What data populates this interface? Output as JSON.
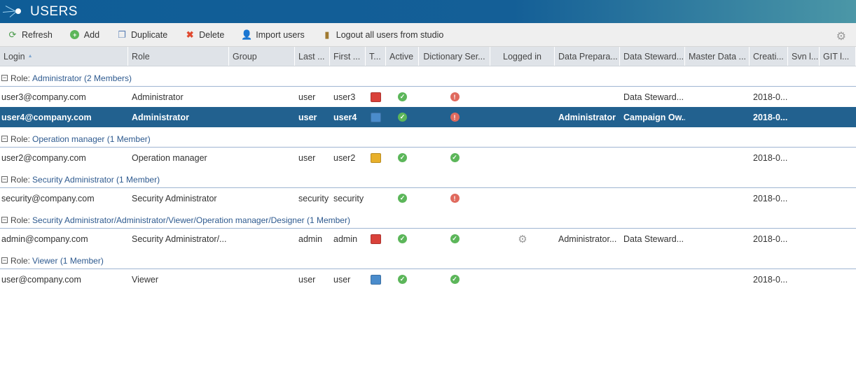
{
  "title": "USERS",
  "toolbar": {
    "refresh": "Refresh",
    "add": "Add",
    "duplicate": "Duplicate",
    "delete": "Delete",
    "import": "Import users",
    "logout": "Logout all users from studio"
  },
  "columns": [
    "Login",
    "Role",
    "Group",
    "Last ...",
    "First ...",
    "T...",
    "Active",
    "Dictionary Ser...",
    "Logged in",
    "Data Prepara...",
    "Data Steward...",
    "Master Data ...",
    "Creati...",
    "Svn l...",
    "GIT l..."
  ],
  "sort_indicator": "▲",
  "groups": [
    {
      "prefix": "Role:",
      "name": "Administrator (2 Members)",
      "rows": [
        {
          "login": "user3@company.com",
          "role": "Administrator",
          "group": "",
          "last": "user",
          "first": "user3",
          "type": "red",
          "active": "ok",
          "dict": "err",
          "logged": "",
          "prep": "",
          "steward": "Data Steward...",
          "master": "",
          "created": "2018-0...",
          "svn": "",
          "git": "",
          "selected": false
        },
        {
          "login": "user4@company.com",
          "role": "Administrator",
          "group": "",
          "last": "user",
          "first": "user4",
          "type": "blue",
          "active": "ok",
          "dict": "err",
          "logged": "",
          "prep": "Administrator",
          "steward": "Campaign Ow...",
          "master": "",
          "created": "2018-0...",
          "svn": "",
          "git": "",
          "selected": true
        }
      ]
    },
    {
      "prefix": "Role:",
      "name": "Operation manager (1 Member)",
      "rows": [
        {
          "login": "user2@company.com",
          "role": "Operation manager",
          "group": "",
          "last": "user",
          "first": "user2",
          "type": "yellow",
          "active": "ok",
          "dict": "ok",
          "logged": "",
          "prep": "",
          "steward": "",
          "master": "",
          "created": "2018-0...",
          "svn": "",
          "git": "",
          "selected": false
        }
      ]
    },
    {
      "prefix": "Role:",
      "name": "Security Administrator (1 Member)",
      "rows": [
        {
          "login": "security@company.com",
          "role": "Security Administrator",
          "group": "",
          "last": "security",
          "first": "security",
          "type": "",
          "active": "ok",
          "dict": "err",
          "logged": "",
          "prep": "",
          "steward": "",
          "master": "",
          "created": "2018-0...",
          "svn": "",
          "git": "",
          "selected": false
        }
      ]
    },
    {
      "prefix": "Role:",
      "name": "Security Administrator/Administrator/Viewer/Operation manager/Designer (1 Member)",
      "rows": [
        {
          "login": "admin@company.com",
          "role": "Security Administrator/...",
          "group": "",
          "last": "admin",
          "first": "admin",
          "type": "red",
          "active": "ok",
          "dict": "ok",
          "logged": "gear",
          "prep": "Administrator...",
          "steward": "Data Steward...",
          "master": "",
          "created": "2018-0...",
          "svn": "",
          "git": "",
          "selected": false
        }
      ]
    },
    {
      "prefix": "Role:",
      "name": "Viewer (1 Member)",
      "rows": [
        {
          "login": "user@company.com",
          "role": "Viewer",
          "group": "",
          "last": "user",
          "first": "user",
          "type": "blue",
          "active": "ok",
          "dict": "ok",
          "logged": "",
          "prep": "",
          "steward": "",
          "master": "",
          "created": "2018-0...",
          "svn": "",
          "git": "",
          "selected": false
        }
      ]
    }
  ]
}
